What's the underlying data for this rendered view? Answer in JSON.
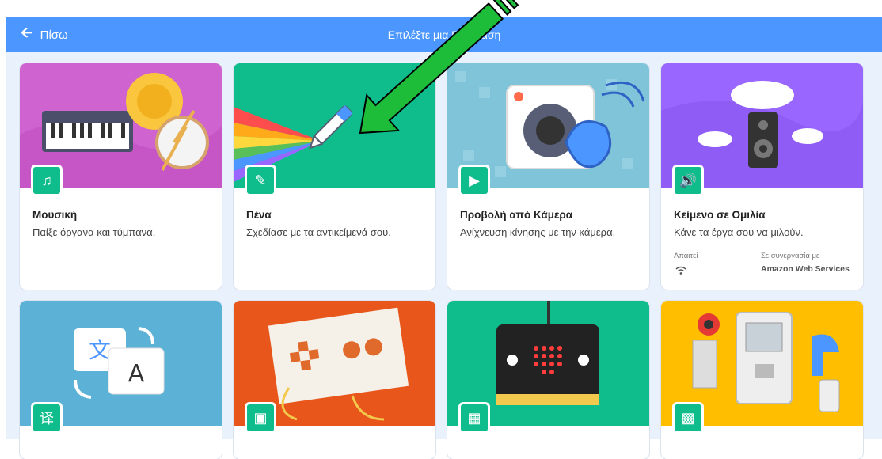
{
  "header": {
    "back_label": "Πίσω",
    "title": "Επιλέξτε μια Επέκταση"
  },
  "colors": {
    "header": "#4c97ff",
    "background": "#e9f1fc",
    "badge": "#0fbd8c",
    "arrow_fill": "#1dbd3a"
  },
  "extensions": [
    {
      "title": "Μουσική",
      "description": "Παίξε όργανα και τύμπανα.",
      "icon": "music-icon"
    },
    {
      "title": "Πένα",
      "description": "Σχεδίασε με τα αντικείμενά σου.",
      "icon": "pen-icon"
    },
    {
      "title": "Προβολή από Κάμερα",
      "description": "Ανίχνευση κίνησης με την κάμερα.",
      "icon": "video-sensing-icon"
    },
    {
      "title": "Κείμενο σε Ομιλία",
      "description": "Κάνε τα έργα σου να μιλούν.",
      "icon": "text-to-speech-icon",
      "requires_label": "Απαιτεί",
      "requires_icon": "wifi-icon",
      "collab_label": "Σε συνεργασία με",
      "collab_name": "Amazon Web Services"
    },
    {
      "title": "",
      "description": "",
      "icon": "translate-icon"
    },
    {
      "title": "",
      "description": "",
      "icon": "makey-makey-icon"
    },
    {
      "title": "",
      "description": "",
      "icon": "microbit-icon"
    },
    {
      "title": "",
      "description": "",
      "icon": "lego-ev3-icon"
    }
  ]
}
